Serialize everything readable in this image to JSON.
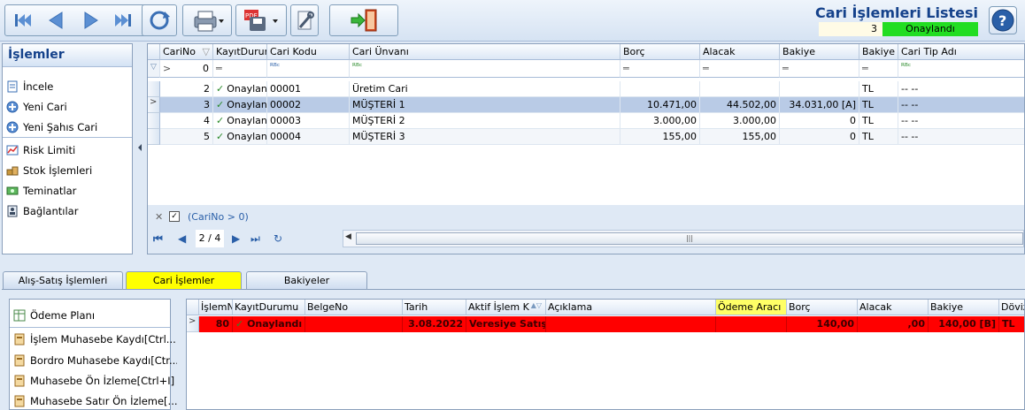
{
  "toolbar": {
    "title": "Cari İşlemleri Listesi",
    "count": "3",
    "status": "Onaylandı"
  },
  "left_panel": {
    "header": "İşlemler",
    "items": [
      "İncele",
      "Yeni Cari",
      "Yeni Şahıs Cari",
      "Risk Limiti",
      "Stok İşlemleri",
      "Teminatlar",
      "Bağlantılar"
    ]
  },
  "grid": {
    "columns": [
      "CariNo",
      "KayıtDurumu",
      "Cari Kodu",
      "Cari Ünvanı",
      "Borç",
      "Alacak",
      "Bakiye",
      "Bakiye D",
      "Cari Tip Adı"
    ],
    "filter": {
      "carino": "0",
      "equals": "═",
      "abc": "ᴿᴮᶜ"
    },
    "rows": [
      {
        "carino": "2",
        "durum": "Onaylan",
        "kod": "00001",
        "unvan": "Üretim Cari",
        "borc": "",
        "alacak": "",
        "bakiye": "",
        "bd": "TL",
        "tip": "-- --"
      },
      {
        "carino": "3",
        "durum": "Onaylan",
        "kod": "00002",
        "unvan": "MÜŞTERİ 1",
        "borc": "10.471,00",
        "alacak": "44.502,00",
        "bakiye": "34.031,00 [A]",
        "bd": "TL",
        "tip": "-- --"
      },
      {
        "carino": "4",
        "durum": "Onaylan",
        "kod": "00003",
        "unvan": "MÜŞTERİ 2",
        "borc": "3.000,00",
        "alacak": "3.000,00",
        "bakiye": "0",
        "bd": "TL",
        "tip": "-- --"
      },
      {
        "carino": "5",
        "durum": "Onaylan",
        "kod": "00004",
        "unvan": "MÜŞTERİ 3",
        "borc": "155,00",
        "alacak": "155,00",
        "bakiye": "0",
        "bd": "TL",
        "tip": "-- --"
      }
    ],
    "filter_text": "(CariNo > 0)",
    "page": "2 / 4"
  },
  "tabs": [
    "Alış-Satış İşlemleri",
    "Cari İşlemler",
    "Bakiyeler"
  ],
  "bottom_panel": {
    "items": [
      "Ödeme Planı",
      "İşlem Muhasebe Kaydı[Ctrl...",
      "Bordro Muhasebe Kaydı[Ctr...",
      "Muhasebe Ön İzleme[Ctrl+I]",
      "Muhasebe Satır Ön İzleme[..."
    ]
  },
  "bottom_grid": {
    "columns": [
      "İşlemNo",
      "KayıtDurumu",
      "BelgeNo",
      "Tarih",
      "Aktif İşlem K",
      "Açıklama",
      "Ödeme Aracı",
      "Borç",
      "Alacak",
      "Bakiye",
      "Döviz"
    ],
    "row": {
      "no": "80",
      "durum": "Onaylandı",
      "belge": "",
      "tarih": "3.08.2022",
      "islem": "Veresiye Satış",
      "aciklama": "",
      "arac": "",
      "borc": "140,00",
      "alacak": ",00",
      "bakiye": "140,00 [B]",
      "doviz": "TL"
    }
  },
  "colors": {
    "accent": "#15428b",
    "selected_row": "#b9cbe6",
    "highlight": "#ff0000",
    "status_green": "#22dd22",
    "tab_active": "#ffff00"
  }
}
